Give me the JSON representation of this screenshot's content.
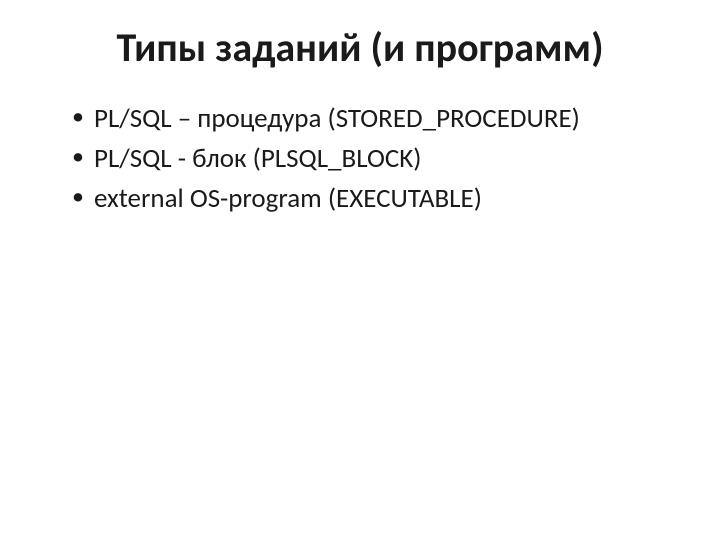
{
  "slide": {
    "title": "Типы заданий (и программ)",
    "bullets": [
      "PL/SQL – процедура (STORED_PROCEDURE)",
      "PL/SQL  - блок (PLSQL_BLOCK)",
      "external OS-program (EXECUTABLE)"
    ]
  }
}
